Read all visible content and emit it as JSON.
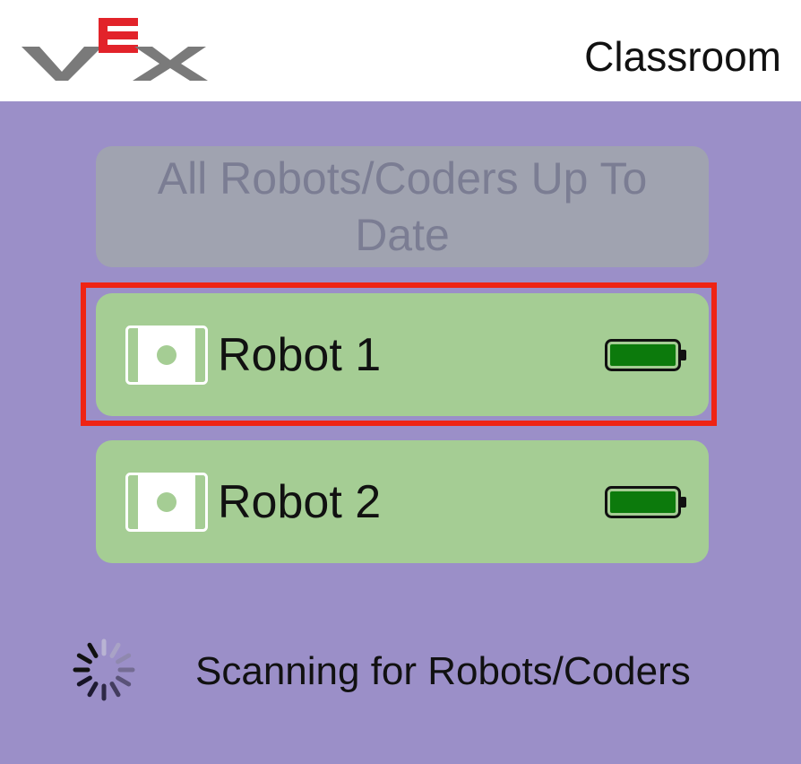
{
  "header": {
    "logo_icon": "vex-logo-icon",
    "title": "Classroom"
  },
  "main": {
    "update_button_label": "All Robots/Coders Up To Date",
    "robots": [
      {
        "name": "Robot 1",
        "icon": "brain-icon",
        "battery": 1.0,
        "battery_icon": "battery-full-icon",
        "selected": true
      },
      {
        "name": "Robot 2",
        "icon": "brain-icon",
        "battery": 1.0,
        "battery_icon": "battery-full-icon",
        "selected": false
      }
    ],
    "status_text": "Scanning for Robots/Coders",
    "status_icon": "spinner-icon"
  },
  "colors": {
    "background": "#9b8fc8",
    "header": "#ffffff",
    "card": "#a5cd94",
    "disabled_button": "#a0a3b0",
    "selection": "#ef2414",
    "battery_fill": "#0c7a0c",
    "logo_gray": "#7a7a7a",
    "logo_red": "#e2232a"
  }
}
